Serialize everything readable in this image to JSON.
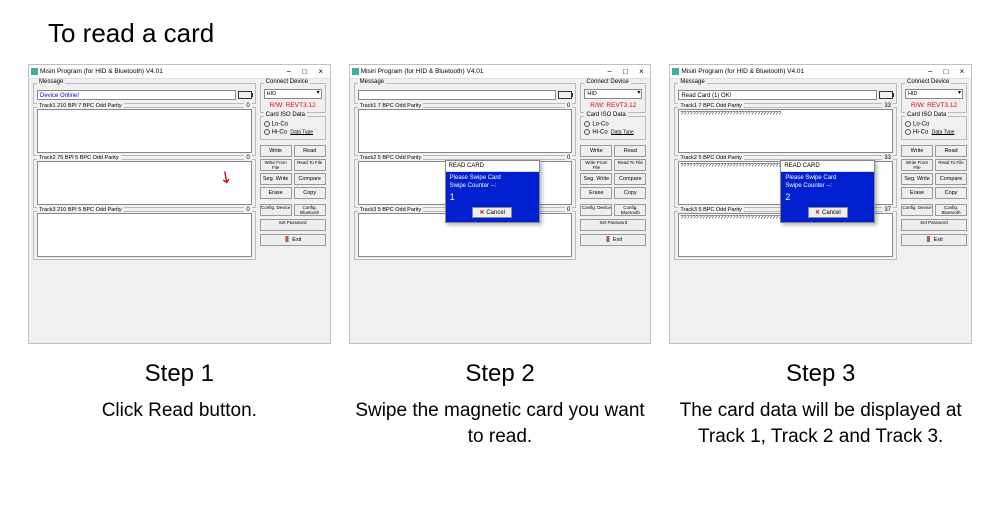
{
  "title": "To read a card",
  "app": {
    "title": "Misiri Program (for HID & Bluetooth) V4.01",
    "message_label": "Message",
    "connect_device_label": "Connect Device",
    "device_select": "HID",
    "rw_version": "R/W: REVT3.12",
    "card_iso_label": "Card ISO Data",
    "radio_loco": "Lo-Co",
    "radio_hico": "Hi-Co",
    "data_type_btn": "Data Type",
    "buttons": {
      "write": "Write",
      "read": "Read",
      "write_from_file": "Write From File",
      "read_to_file": "Read To File",
      "seg_write": "Seg. Write",
      "compare": "Compare",
      "erase": "Erase",
      "copy": "Copy",
      "config_device": "Config. Device",
      "config_bluetooth": "Config. Bluetooth",
      "set_password": "Set Password",
      "exit": "Exit"
    }
  },
  "step1": {
    "label": "Step 1",
    "desc": "Click Read button.",
    "message": "Device Online!",
    "track1_label": "Track1   210 BPI  7 BPC  Odd Parity",
    "track1_count": "0",
    "track2_label": "Track2   75 BPI  5 BPC  Odd Parity",
    "track2_count": "0",
    "track3_label": "Track3   210 BPI  5 BPC  Odd Parity",
    "track3_count": "0"
  },
  "step2": {
    "label": "Step 2",
    "desc": "Swipe the magnetic card you want to read.",
    "message": "",
    "track1_label": "Track1   7 BPC  Odd Parity",
    "track1_count": "0",
    "track2_label": "Track2   5 BPC  Odd Parity",
    "track2_count": "0",
    "track3_label": "Track3   5 BPC  Odd Parity",
    "track3_count": "0",
    "modal": {
      "title": "READ CARD",
      "line1": "Please Swipe Card",
      "line2": "Swipe Counter --:",
      "counter": "1",
      "cancel": "Cancel"
    }
  },
  "step3": {
    "label": "Step 3",
    "desc": "The card data will be displayed at Track 1, Track 2 and Track 3.",
    "message": "Read Card (1) OK!",
    "track1_label": "Track1   7 BPC  Odd Parity",
    "track1_count": "33",
    "track1_data": "?????????????????????????????????",
    "track2_label": "Track2   5 BPC  Odd Parity",
    "track2_count": "33",
    "track2_data": "?????????????????????????????????",
    "track3_label": "Track3   5 BPC  Odd Parity",
    "track3_count": "37",
    "track3_data": "?????????????????????????????????????",
    "modal": {
      "title": "READ CARD",
      "line1": "Please Swipe Card",
      "line2": "Swipe Counter --:",
      "counter": "2",
      "cancel": "Cancel"
    }
  }
}
